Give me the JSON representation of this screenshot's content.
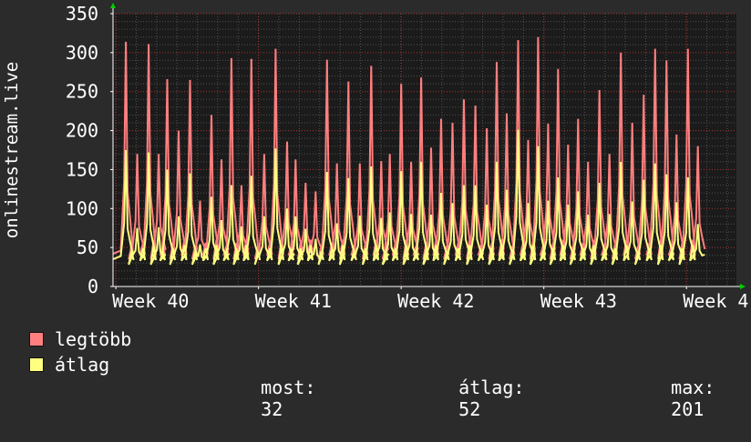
{
  "chart_data": {
    "type": "line",
    "ylabel": "onlinestream.live",
    "xlabel": "",
    "ylim": [
      0,
      350
    ],
    "y_ticks": [
      0,
      50,
      100,
      150,
      200,
      250,
      300,
      350
    ],
    "x_ticks": [
      {
        "label": "Week 40",
        "pos": 0
      },
      {
        "label": "Week 41",
        "pos": 1
      },
      {
        "label": "Week 42",
        "pos": 2
      },
      {
        "label": "Week 43",
        "pos": 3
      },
      {
        "label": "Week 4",
        "pos": 4
      }
    ],
    "x_range": [
      -0.02,
      4.35
    ],
    "grid": true,
    "series": [
      {
        "name": "legtöbb",
        "color": "#ff7f7f",
        "peaks": [
          {
            "x": 0.07,
            "y": 314
          },
          {
            "x": 0.15,
            "y": 170
          },
          {
            "x": 0.23,
            "y": 311
          },
          {
            "x": 0.3,
            "y": 170
          },
          {
            "x": 0.36,
            "y": 266
          },
          {
            "x": 0.44,
            "y": 200
          },
          {
            "x": 0.52,
            "y": 265
          },
          {
            "x": 0.59,
            "y": 110
          },
          {
            "x": 0.67,
            "y": 220
          },
          {
            "x": 0.74,
            "y": 163
          },
          {
            "x": 0.81,
            "y": 293
          },
          {
            "x": 0.88,
            "y": 130
          },
          {
            "x": 0.95,
            "y": 292
          },
          {
            "x": 1.04,
            "y": 170
          },
          {
            "x": 1.12,
            "y": 305
          },
          {
            "x": 1.2,
            "y": 186
          },
          {
            "x": 1.26,
            "y": 163
          },
          {
            "x": 1.33,
            "y": 133
          },
          {
            "x": 1.4,
            "y": 122
          },
          {
            "x": 1.48,
            "y": 291
          },
          {
            "x": 1.55,
            "y": 158
          },
          {
            "x": 1.63,
            "y": 263
          },
          {
            "x": 1.71,
            "y": 158
          },
          {
            "x": 1.79,
            "y": 283
          },
          {
            "x": 1.86,
            "y": 161
          },
          {
            "x": 1.92,
            "y": 170
          },
          {
            "x": 2.0,
            "y": 260
          },
          {
            "x": 2.07,
            "y": 160
          },
          {
            "x": 2.14,
            "y": 268
          },
          {
            "x": 2.21,
            "y": 178
          },
          {
            "x": 2.28,
            "y": 215
          },
          {
            "x": 2.36,
            "y": 210
          },
          {
            "x": 2.44,
            "y": 240
          },
          {
            "x": 2.52,
            "y": 232
          },
          {
            "x": 2.6,
            "y": 203
          },
          {
            "x": 2.67,
            "y": 288
          },
          {
            "x": 2.74,
            "y": 222
          },
          {
            "x": 2.82,
            "y": 316
          },
          {
            "x": 2.89,
            "y": 188
          },
          {
            "x": 2.96,
            "y": 320
          },
          {
            "x": 3.03,
            "y": 209
          },
          {
            "x": 3.1,
            "y": 279
          },
          {
            "x": 3.17,
            "y": 182
          },
          {
            "x": 3.24,
            "y": 215
          },
          {
            "x": 3.31,
            "y": 160
          },
          {
            "x": 3.39,
            "y": 252
          },
          {
            "x": 3.46,
            "y": 170
          },
          {
            "x": 3.54,
            "y": 300
          },
          {
            "x": 3.62,
            "y": 210
          },
          {
            "x": 3.7,
            "y": 246
          },
          {
            "x": 3.78,
            "y": 305
          },
          {
            "x": 3.86,
            "y": 290
          },
          {
            "x": 3.93,
            "y": 195
          },
          {
            "x": 4.01,
            "y": 305
          },
          {
            "x": 4.08,
            "y": 180
          }
        ]
      },
      {
        "name": "átlag",
        "color": "#ffff80",
        "peaks": [
          {
            "x": 0.07,
            "y": 175
          },
          {
            "x": 0.15,
            "y": 75
          },
          {
            "x": 0.23,
            "y": 172
          },
          {
            "x": 0.3,
            "y": 76
          },
          {
            "x": 0.36,
            "y": 150
          },
          {
            "x": 0.44,
            "y": 90
          },
          {
            "x": 0.52,
            "y": 145
          },
          {
            "x": 0.59,
            "y": 54
          },
          {
            "x": 0.67,
            "y": 115
          },
          {
            "x": 0.74,
            "y": 85
          },
          {
            "x": 0.81,
            "y": 130
          },
          {
            "x": 0.88,
            "y": 77
          },
          {
            "x": 0.95,
            "y": 142
          },
          {
            "x": 1.04,
            "y": 90
          },
          {
            "x": 1.12,
            "y": 177
          },
          {
            "x": 1.2,
            "y": 100
          },
          {
            "x": 1.26,
            "y": 90
          },
          {
            "x": 1.33,
            "y": 74
          },
          {
            "x": 1.4,
            "y": 61
          },
          {
            "x": 1.48,
            "y": 147
          },
          {
            "x": 1.55,
            "y": 81
          },
          {
            "x": 1.63,
            "y": 139
          },
          {
            "x": 1.71,
            "y": 91
          },
          {
            "x": 1.79,
            "y": 154
          },
          {
            "x": 1.86,
            "y": 88
          },
          {
            "x": 1.92,
            "y": 95
          },
          {
            "x": 2.0,
            "y": 148
          },
          {
            "x": 2.07,
            "y": 93
          },
          {
            "x": 2.14,
            "y": 160
          },
          {
            "x": 2.21,
            "y": 92
          },
          {
            "x": 2.28,
            "y": 120
          },
          {
            "x": 2.36,
            "y": 107
          },
          {
            "x": 2.44,
            "y": 130
          },
          {
            "x": 2.52,
            "y": 130
          },
          {
            "x": 2.6,
            "y": 105
          },
          {
            "x": 2.67,
            "y": 160
          },
          {
            "x": 2.74,
            "y": 124
          },
          {
            "x": 2.82,
            "y": 201
          },
          {
            "x": 2.89,
            "y": 107
          },
          {
            "x": 2.96,
            "y": 180
          },
          {
            "x": 3.03,
            "y": 110
          },
          {
            "x": 3.1,
            "y": 140
          },
          {
            "x": 3.17,
            "y": 105
          },
          {
            "x": 3.24,
            "y": 122
          },
          {
            "x": 3.31,
            "y": 92
          },
          {
            "x": 3.39,
            "y": 133
          },
          {
            "x": 3.46,
            "y": 93
          },
          {
            "x": 3.54,
            "y": 160
          },
          {
            "x": 3.62,
            "y": 109
          },
          {
            "x": 3.7,
            "y": 137
          },
          {
            "x": 3.78,
            "y": 158
          },
          {
            "x": 3.86,
            "y": 144
          },
          {
            "x": 3.93,
            "y": 108
          },
          {
            "x": 4.01,
            "y": 140
          },
          {
            "x": 4.08,
            "y": 80
          }
        ]
      }
    ]
  },
  "legend": {
    "items": [
      {
        "label": "legtöbb",
        "color": "#ff7f7f"
      },
      {
        "label": "átlag",
        "color": "#ffff80"
      }
    ],
    "stats": {
      "now_label": "most:",
      "now_value": "32",
      "avg_label": "átlag:",
      "avg_value": "52",
      "max_label": "max:",
      "max_value": "201"
    }
  },
  "colors": {
    "background": "#2b2b2b",
    "plot_background": "#1b1b1b",
    "grid": "#505050",
    "major_grid": "#b03030",
    "axis": "#ffffff",
    "arrow": "#00cc00"
  }
}
